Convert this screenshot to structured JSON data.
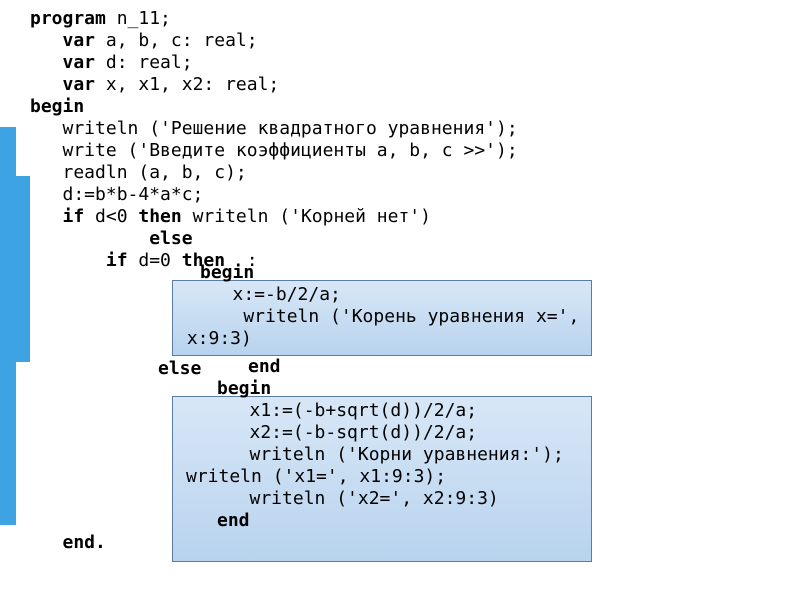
{
  "code": {
    "l1a": "program",
    "l1b": " n_11;",
    "l2a": "   var",
    "l2b": " a, b, c: real;",
    "l3a": "   var",
    "l3b": " d: real;",
    "l4a": "   var",
    "l4b": " x, x1, x2: real;",
    "l5": "begin",
    "l6": "   writeln ('Решение квадратного уравнения');",
    "l7": "   write ('Введите коэффициенты a, b, c >>');",
    "l8": "   readln (a, b, c);",
    "l9": "   d:=b*b-4*a*c;",
    "l10a": "   if",
    "l10b": " d<0 ",
    "l10c": "then",
    "l10d": " writeln ('Корней нет')",
    "l11": "           else",
    "l12a": "       if",
    "l12b": " d=0 ",
    "l12c": "then  ",
    "l12d": ":"
  },
  "box1": {
    "begin": "begin",
    "b1": "   x:=-b/2/a;",
    "b2": "    writeln ('Корень уравнения x=',",
    "b3": " x:9:3)",
    "end": "end"
  },
  "mid": {
    "else": "else"
  },
  "box2": {
    "begin": "begin",
    "c1": "   x1:=(-b+sqrt(d))/2/a;",
    "c2": "   x2:=(-b-sqrt(d))/2/a;",
    "c3": "   writeln ('Корни уравнения:');",
    "c4": "writeln ('x1=', x1:9:3);",
    "c5": "   writeln ('x2=', x2:9:3)",
    "end": "end"
  },
  "tail": {
    "end": "   end."
  }
}
